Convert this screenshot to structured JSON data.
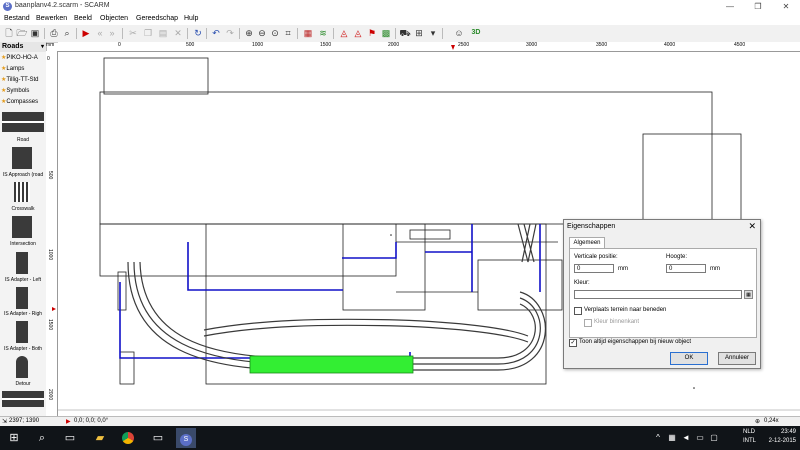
{
  "window": {
    "title": "baanplanv4.2.scarm - SCARM",
    "app_icon": "S",
    "minimize": "—",
    "maximize": "❐",
    "close": "✕"
  },
  "menu": [
    "Bestand",
    "Bewerken",
    "Beeld",
    "Objecten",
    "Gereedschap",
    "Hulp"
  ],
  "toolbar_icons": [
    "new-file-icon",
    "open-folder-icon",
    "save-icon",
    "print-icon",
    "print-preview-icon",
    "run-icon",
    "step-back-icon",
    "step-forward-icon",
    "cut-icon",
    "copy-icon",
    "paste-icon",
    "delete-icon",
    "rotate-icon",
    "undo-icon",
    "redo-icon",
    "zoom-in-icon",
    "zoom-out-icon",
    "zoom-fit-icon",
    "zoom-window-icon",
    "layers-icon",
    "sign-icon",
    "sign2-icon",
    "flag-icon",
    "grid-icon",
    "train-icon",
    "person-icon",
    "3d-car-icon"
  ],
  "library": {
    "dropdown": "Roads",
    "categories": [
      "PIKO-HO-A",
      "Lamps",
      "Tillig-TT-Std",
      "Symbols",
      "Compasses"
    ],
    "items": [
      "Road",
      "IS Approach (road",
      "Crosswalk",
      "Intersection",
      "IS Adapter - Left",
      "IS Adapter - Righ",
      "IS Adapter - Both",
      "Detour"
    ]
  },
  "rulers": {
    "unit": "mm",
    "h_ticks": [
      "0",
      "500",
      "1000",
      "1500",
      "2000",
      "2500",
      "3000",
      "3500",
      "4000",
      "4500"
    ],
    "v_ticks": [
      "0",
      "500",
      "1000",
      "1500",
      "2000"
    ]
  },
  "dialog": {
    "title": "Eigenschappen",
    "close": "✕",
    "tab": "Algemeen",
    "vert_label": "Verticale positie:",
    "vert_value": "0",
    "vert_unit": "mm",
    "height_label": "Hoogte:",
    "height_value": "0",
    "height_unit": "mm",
    "color_label": "Kleur:",
    "color_value": "",
    "move_terrain_label": "Verplaats terrein naar beneden",
    "move_terrain_checked": false,
    "inner_color_label": "Kleur binnenkant",
    "always_show_label": "Toon altijd eigenschappen bij nieuw object",
    "always_show_checked": true,
    "ok": "OK",
    "cancel": "Annuleer"
  },
  "status": {
    "coords": "2397; 1390",
    "position": "0,0; 0,0; 0,0°",
    "zoom": "0,24x"
  },
  "taskbar": {
    "apps": [
      "windows-icon",
      "search-icon",
      "task-view-icon",
      "file-explorer-icon",
      "chrome-icon",
      "messaging-icon",
      "scarm-icon"
    ],
    "lang1": "NLD",
    "lang2": "INTL",
    "time": "23:49",
    "date": "2-12-2015"
  },
  "colors": {
    "highlight": "#33ee33",
    "wire": "#1010c8",
    "track": "#3a3a3a"
  }
}
